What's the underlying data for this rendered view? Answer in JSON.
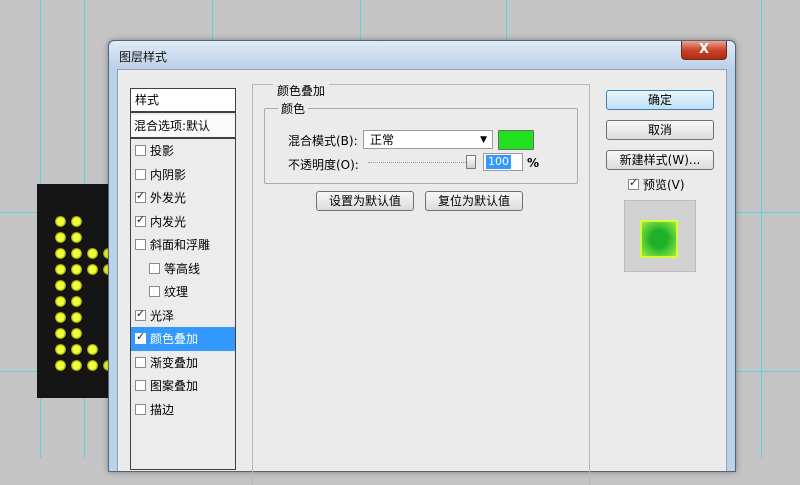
{
  "dialog": {
    "title": "图层样式",
    "close_label": "X"
  },
  "styles_list": {
    "header": "样式",
    "blend_options": "混合选项:默认",
    "items": [
      {
        "label": "投影",
        "checked": false,
        "sub": false,
        "active": false
      },
      {
        "label": "内阴影",
        "checked": false,
        "sub": false,
        "active": false
      },
      {
        "label": "外发光",
        "checked": true,
        "sub": false,
        "active": false
      },
      {
        "label": "内发光",
        "checked": true,
        "sub": false,
        "active": false
      },
      {
        "label": "斜面和浮雕",
        "checked": false,
        "sub": false,
        "active": false
      },
      {
        "label": "等高线",
        "checked": false,
        "sub": true,
        "active": false
      },
      {
        "label": "纹理",
        "checked": false,
        "sub": true,
        "active": false
      },
      {
        "label": "光泽",
        "checked": true,
        "sub": false,
        "active": false
      },
      {
        "label": "颜色叠加",
        "checked": true,
        "sub": false,
        "active": true
      },
      {
        "label": "渐变叠加",
        "checked": false,
        "sub": false,
        "active": false
      },
      {
        "label": "图案叠加",
        "checked": false,
        "sub": false,
        "active": false
      },
      {
        "label": "描边",
        "checked": false,
        "sub": false,
        "active": false
      }
    ]
  },
  "panel": {
    "section_title": "颜色叠加",
    "group_title": "颜色",
    "blend_mode_label": "混合模式(B):",
    "blend_mode_value": "正常",
    "overlay_color": "#21e01f",
    "opacity_label": "不透明度(O):",
    "opacity_value": "100",
    "opacity_unit": "%",
    "opacity_level": 1.0,
    "set_default_button": "设置为默认值",
    "reset_default_button": "复位为默认值"
  },
  "buttons": {
    "ok": "确定",
    "cancel": "取消",
    "new_style": "新建样式(W)..."
  },
  "preview": {
    "label": "预览(V)",
    "checked": true
  }
}
